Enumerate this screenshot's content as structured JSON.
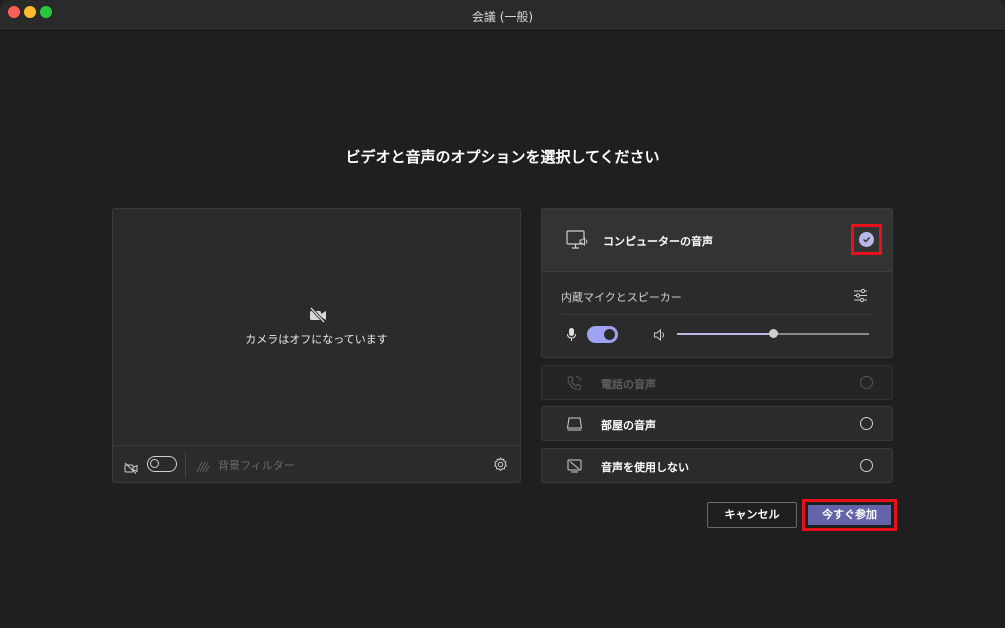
{
  "window": {
    "title": "会議 (一般)"
  },
  "heading": "ビデオと音声のオプションを選択してください",
  "video": {
    "camera_off_text": "カメラはオフになっています",
    "camera_toggle": "off",
    "background_filter_label": "背景フィルター"
  },
  "audio": {
    "computer_audio_label": "コンピューターの音声",
    "computer_audio_selected": true,
    "device_label": "内蔵マイクとスピーカー",
    "mic_enabled": true,
    "volume_level": 0.5,
    "options": [
      {
        "label": "電話の音声",
        "enabled": false
      },
      {
        "label": "部屋の音声",
        "enabled": true
      },
      {
        "label": "音声を使用しない",
        "enabled": true
      }
    ]
  },
  "buttons": {
    "cancel_label": "キャンセル",
    "join_label": "今すぐ参加"
  },
  "colors": {
    "accent": "#6264a7",
    "accent_light": "#9ea2f0",
    "highlight_box": "#e8101a",
    "background": "#1f1f1f"
  }
}
